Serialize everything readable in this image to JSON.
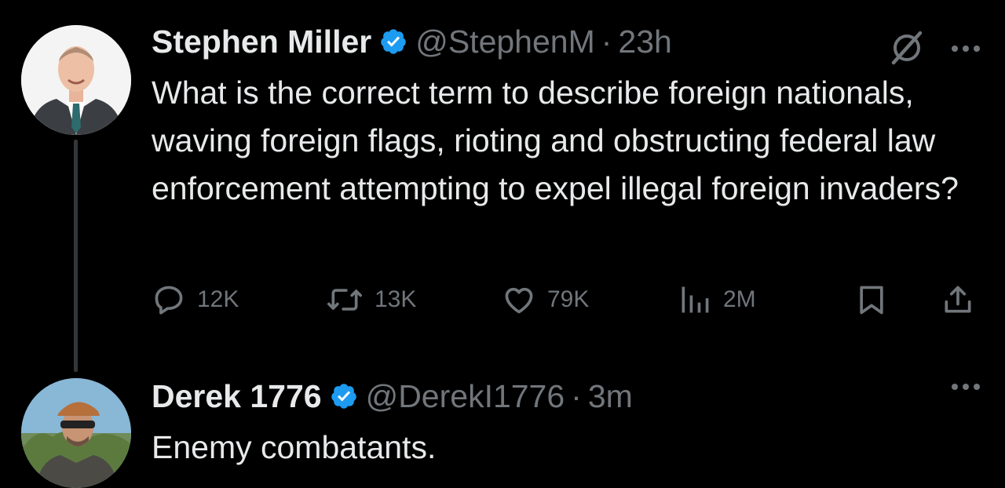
{
  "original_post": {
    "author_name": "Stephen Miller",
    "handle": "@StephenM",
    "separator": "·",
    "time": "23h",
    "text": "What is the correct term to describe foreign nationals, waving foreign flags, rioting and obstructing federal law enforcement attempting to expel illegal foreign invaders?",
    "icons": {
      "verified": "verified-badge-icon",
      "top_right": [
        "grok-icon",
        "more-icon"
      ]
    },
    "stats": {
      "replies": "12K",
      "reposts": "13K",
      "likes": "79K",
      "views": "2M"
    }
  },
  "reply": {
    "author_name": "Derek 1776",
    "handle": "@DerekI1776",
    "separator": "·",
    "time": "3m",
    "text": "Enemy combatants.",
    "icons": {
      "verified": "verified-badge-icon",
      "top_right": [
        "more-icon"
      ]
    }
  },
  "colors": {
    "background": "#000000",
    "primary_text": "#e7e9ea",
    "secondary_text": "#71767b",
    "verified_badge": "#1d9bf0",
    "thread_line": "#333639"
  }
}
